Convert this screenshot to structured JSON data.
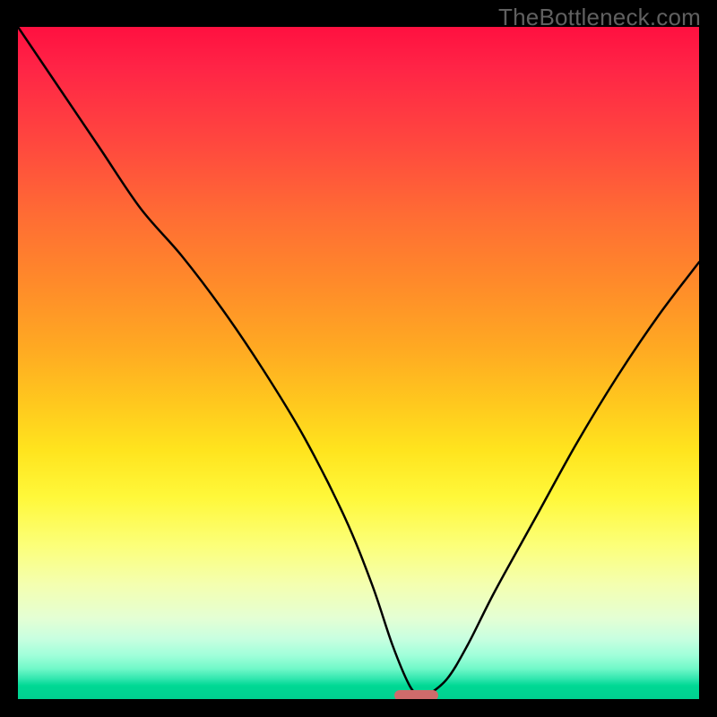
{
  "watermark": {
    "text": "TheBottleneck.com"
  },
  "chart_data": {
    "type": "line",
    "title": "",
    "xlabel": "",
    "ylabel": "",
    "xlim": [
      0,
      100
    ],
    "ylim": [
      0,
      100
    ],
    "series": [
      {
        "name": "bottleneck-curve",
        "x": [
          0,
          6,
          12,
          18,
          24,
          30,
          36,
          42,
          48,
          52,
          55,
          57.5,
          59,
          60,
          63,
          66,
          70,
          76,
          82,
          88,
          94,
          100
        ],
        "values": [
          100,
          91,
          82,
          73,
          66,
          58,
          49,
          39,
          27,
          17,
          8,
          2,
          0.5,
          0.5,
          3,
          8,
          16,
          27,
          38,
          48,
          57,
          65
        ]
      }
    ],
    "annotations": [
      {
        "name": "optimal-marker",
        "x_center": 58.5,
        "y": 0.6,
        "width": 6.5,
        "height": 1.6,
        "color": "#cf6b6b"
      }
    ],
    "gradient_stops": [
      {
        "pos": 0,
        "color": "#ff1040"
      },
      {
        "pos": 0.5,
        "color": "#ffc81e"
      },
      {
        "pos": 0.7,
        "color": "#fff83a"
      },
      {
        "pos": 0.9,
        "color": "#c8ffe0"
      },
      {
        "pos": 1.0,
        "color": "#00d090"
      }
    ],
    "grid": false,
    "legend": false
  },
  "colors": {
    "background": "#000000",
    "curve": "#000000",
    "marker": "#cf6b6b",
    "watermark": "#606060"
  }
}
